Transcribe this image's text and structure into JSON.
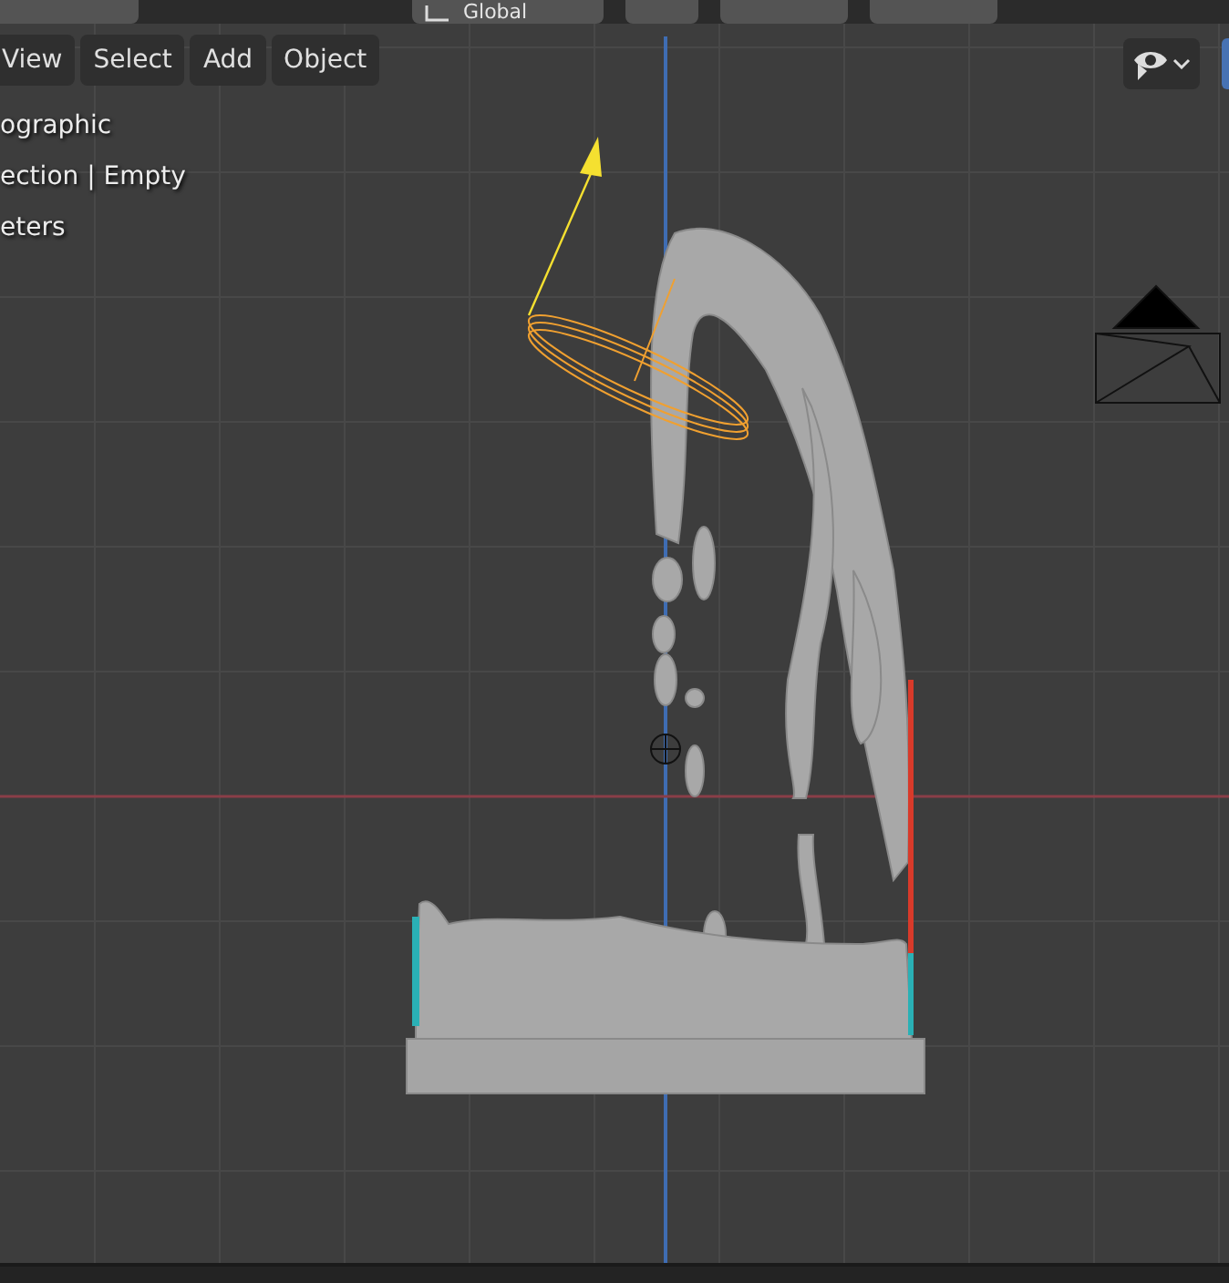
{
  "toolbar": {
    "orientation": "Global"
  },
  "header_menu": [
    {
      "label": "View"
    },
    {
      "label": "Select"
    },
    {
      "label": "Add"
    },
    {
      "label": "Object"
    }
  ],
  "viewport_info": [
    "ographic",
    "ection | Empty",
    "eters"
  ]
}
